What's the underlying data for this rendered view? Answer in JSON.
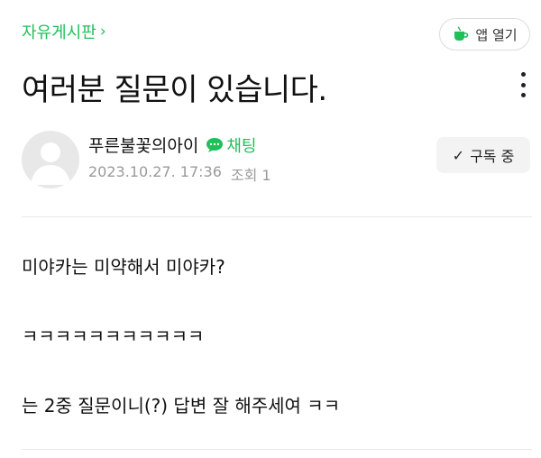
{
  "header": {
    "board_label": "자유게시판",
    "board_chevron": "›",
    "app_button_label": "앱 열기"
  },
  "post": {
    "title": "여러분 질문이 있습니다.",
    "author": "푸른불꽃의아이",
    "chat_label": "채팅",
    "date": "2023.10.27. 17:36",
    "views": "조회 1",
    "subscribe_check": "✓",
    "subscribe_label": "구독 중"
  },
  "content": {
    "lines": [
      "미야카는 미약해서 미야카?",
      "ㅋㅋㅋㅋㅋㅋㅋㅋㅋㅋㅋ",
      "는 2중 질문이니(?) 답변 잘 해주세여 ㅋㅋ"
    ]
  },
  "colors": {
    "accent": "#1fbf5a",
    "meta_text": "#9a9a9a",
    "button_bg": "#f3f3f3"
  }
}
